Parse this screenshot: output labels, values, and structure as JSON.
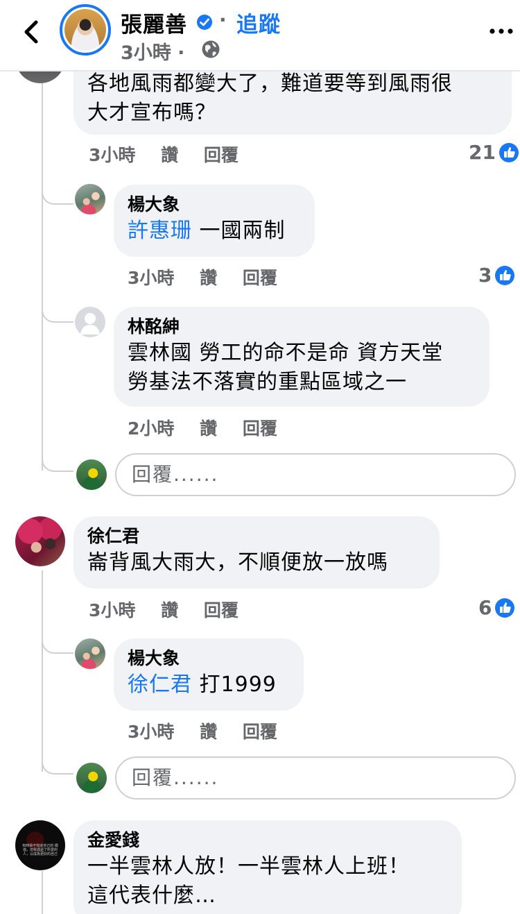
{
  "header": {
    "page_name": "張麗善",
    "separator": "·",
    "follow": "追蹤",
    "post_time": "3小時 ·",
    "back_icon": "chevron-left-icon",
    "more_icon": "more-horizontal-icon",
    "verified_icon": "verified-badge-icon",
    "audience_icon": "globe-icon"
  },
  "comments": [
    {
      "id": "c1",
      "text_lines": [
        "各地風雨都變大了，難道要等到風雨很",
        "大才宣布嗎？"
      ],
      "time": "3小時",
      "like": "讚",
      "reply": "回覆",
      "reactions": "21",
      "replies": [
        {
          "author": "楊大象",
          "mention": "許惠珊",
          "text": " 一國兩制",
          "time": "3小時",
          "like": "讚",
          "reply": "回覆",
          "reactions": "3"
        },
        {
          "author": "林酩紳",
          "text_lines": [
            "雲林國 勞工的命不是命 資方天堂",
            "勞基法不落實的重點區域之一"
          ],
          "time": "2小時",
          "like": "讚",
          "reply": "回覆"
        }
      ],
      "reply_placeholder": "回覆......"
    },
    {
      "id": "c2",
      "author": "徐仁君",
      "text": "崙背風大雨大，不順便放一放嗎",
      "time": "3小時",
      "like": "讚",
      "reply": "回覆",
      "reactions": "6",
      "replies": [
        {
          "author": "楊大象",
          "mention": "徐仁君",
          "text": " 打1999",
          "time": "3小時",
          "like": "讚",
          "reply": "回覆"
        }
      ],
      "reply_placeholder": "回覆......"
    },
    {
      "id": "c3",
      "author": "金愛錢",
      "avatar_text": "有時我不知道自己的 價值，但我遇過了所愛的 人，以成為更好的自己",
      "text_lines": [
        "一半雲林人放！一半雲林人上班！",
        "這代表什麼…"
      ]
    }
  ],
  "colors": {
    "accent": "#1877f2",
    "bubble": "#f0f2f5",
    "secondary_text": "#65676b",
    "thread": "#ced0d4"
  }
}
